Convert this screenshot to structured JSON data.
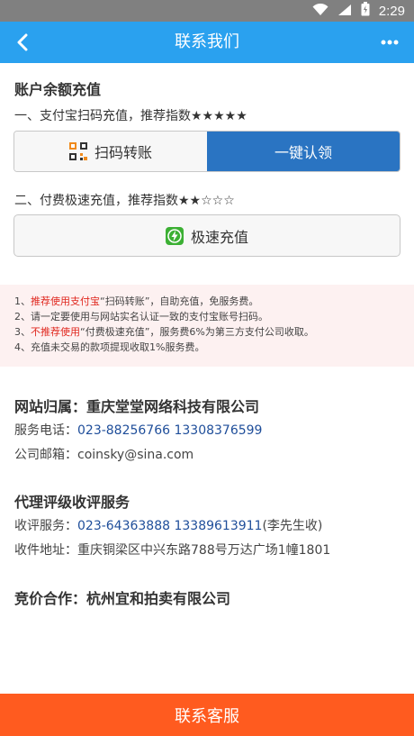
{
  "status_bar": {
    "time": "2:29"
  },
  "app_bar": {
    "title": "联系我们"
  },
  "recharge": {
    "heading": "账户余额充值",
    "line1": "一、支付宝扫码充值，推荐指数★★★★★",
    "scan_btn": "扫码转账",
    "claim_btn": "一键认领",
    "line2": "二、付费极速充值，推荐指数★★☆☆☆",
    "fast_btn": "极速充值"
  },
  "notice": {
    "l1_prefix": "1、",
    "l1_red": "推荐使用支付宝",
    "l1_rest": "“扫码转账”，自助充值，免服务费。",
    "l2": "2、请一定要使用与网站实名认证一致的支付宝账号扫码。",
    "l3_prefix": "3、",
    "l3_red": "不推荐使用",
    "l3_rest": "“付费极速充值”，服务费6%为第三方支付公司收取。",
    "l4": "4、充值未交易的款项提现收取1%服务费。"
  },
  "site": {
    "heading": "网站归属：重庆堂堂网络科技有限公司",
    "phone_label": "服务电话：",
    "phone_value": "023-88256766 13308376599",
    "email_label": "公司邮箱：",
    "email_value": "coinsky@sina.com"
  },
  "agent": {
    "heading": "代理评级收评服务",
    "service_label": "收评服务：",
    "service_value": "023-64363888 13389613911",
    "service_contact": "(李先生收)",
    "address_label": "收件地址：",
    "address_value": "重庆铜梁区中兴东路788号万达广场1幢1801"
  },
  "auction": {
    "heading": "竞价合作：杭州宜和拍卖有限公司"
  },
  "footer": {
    "button": "联系客服"
  },
  "colors": {
    "app_bar": "#2aa1ef",
    "claim": "#2a74c2",
    "footer": "#ff5b1f",
    "link": "#1f4e9a",
    "notice_red": "#e0281f"
  },
  "icons": [
    "wifi-icon",
    "signal-icon",
    "battery-icon",
    "back-arrow-icon",
    "more-icon",
    "qr-code-icon",
    "lightning-icon"
  ]
}
